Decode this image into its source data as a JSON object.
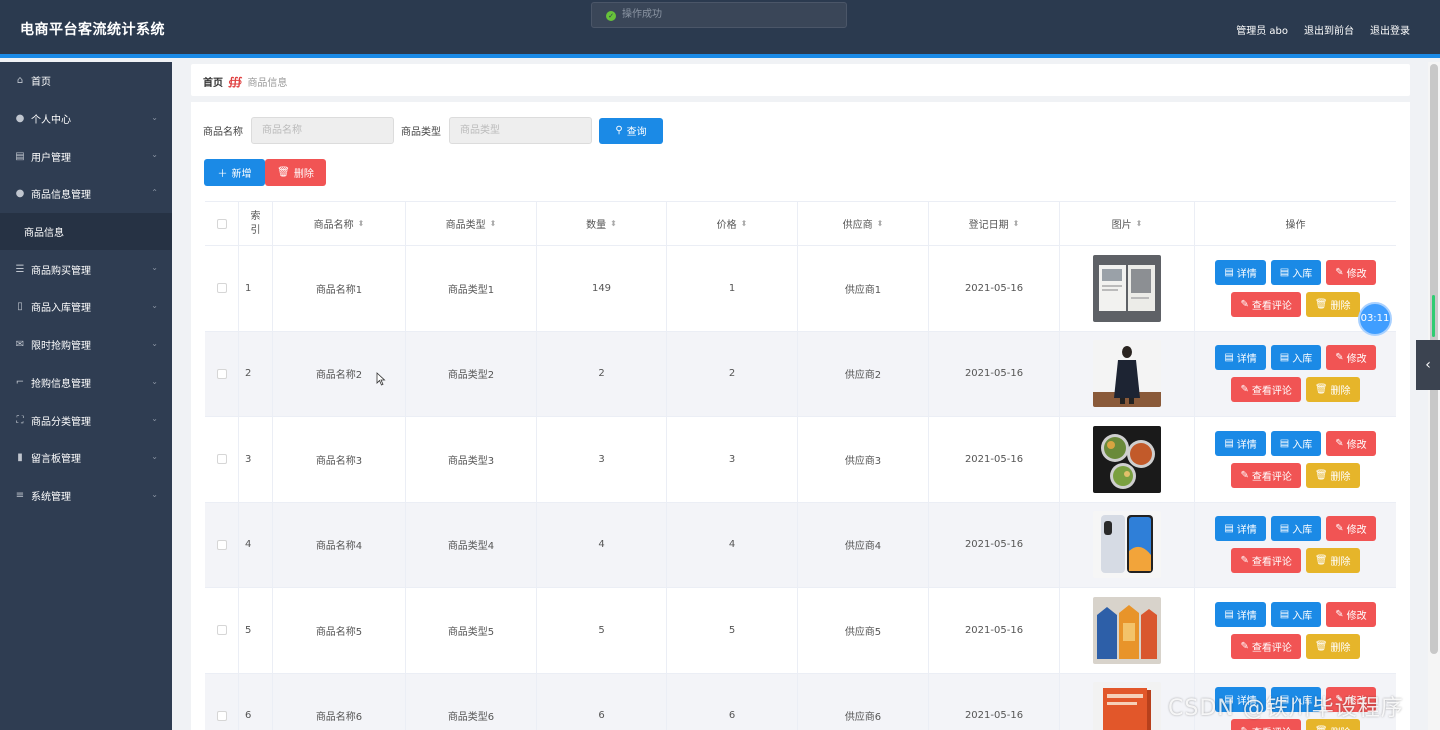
{
  "header": {
    "title": "电商平台客流统计系统",
    "toast": "操作成功",
    "user": "管理员 abo",
    "to_front": "退出到前台",
    "logout": "退出登录"
  },
  "sidebar": {
    "items": [
      {
        "label": "首页",
        "icon": "home-icon"
      },
      {
        "label": "个人中心",
        "icon": "user-icon"
      },
      {
        "label": "用户管理",
        "icon": "clipboard-icon"
      },
      {
        "label": "商品信息管理",
        "icon": "pin-icon"
      },
      {
        "label": "商品信息",
        "icon": ""
      },
      {
        "label": "商品购买管理",
        "icon": "sliders-icon"
      },
      {
        "label": "商品入库管理",
        "icon": "mic-icon"
      },
      {
        "label": "限时抢购管理",
        "icon": "mail-icon"
      },
      {
        "label": "抢购信息管理",
        "icon": "crop-icon"
      },
      {
        "label": "商品分类管理",
        "icon": "fullscreen-icon"
      },
      {
        "label": "留言板管理",
        "icon": "chart-icon"
      },
      {
        "label": "系统管理",
        "icon": "menu-icon"
      }
    ]
  },
  "breadcrumb": {
    "home": "首页",
    "current": "商品信息"
  },
  "search": {
    "name_label": "商品名称",
    "name_placeholder": "商品名称",
    "type_label": "商品类型",
    "type_placeholder": "商品类型",
    "button": "查询"
  },
  "actions": {
    "add": "新增",
    "delete": "删除"
  },
  "table": {
    "headers": {
      "index": "索引",
      "name": "商品名称",
      "type": "商品类型",
      "qty": "数量",
      "price": "价格",
      "supplier": "供应商",
      "date": "登记日期",
      "image": "图片",
      "ops": "操作"
    },
    "buttons": {
      "detail": "详情",
      "stock": "入库",
      "edit": "修改",
      "review": "查看评论",
      "delete": "删除"
    },
    "rows": [
      {
        "idx": "1",
        "name": "商品名称1",
        "type": "商品类型1",
        "qty": "149",
        "price": "1",
        "supplier": "供应商1",
        "date": "2021-05-16"
      },
      {
        "idx": "2",
        "name": "商品名称2",
        "type": "商品类型2",
        "qty": "2",
        "price": "2",
        "supplier": "供应商2",
        "date": "2021-05-16"
      },
      {
        "idx": "3",
        "name": "商品名称3",
        "type": "商品类型3",
        "qty": "3",
        "price": "3",
        "supplier": "供应商3",
        "date": "2021-05-16"
      },
      {
        "idx": "4",
        "name": "商品名称4",
        "type": "商品类型4",
        "qty": "4",
        "price": "4",
        "supplier": "供应商4",
        "date": "2021-05-16"
      },
      {
        "idx": "5",
        "name": "商品名称5",
        "type": "商品类型5",
        "qty": "5",
        "price": "5",
        "supplier": "供应商5",
        "date": "2021-05-16"
      },
      {
        "idx": "6",
        "name": "商品名称6",
        "type": "商品类型6",
        "qty": "6",
        "price": "6",
        "supplier": "供应商6",
        "date": "2021-05-16"
      }
    ]
  },
  "timer": "03:11",
  "watermark": "CSDN @铁川毕设程序",
  "colors": {
    "primary": "#1b8ae6",
    "danger": "#f15454",
    "warning": "#e6b52a",
    "sidebar": "#2f3d52",
    "header": "#2b3a4f"
  }
}
